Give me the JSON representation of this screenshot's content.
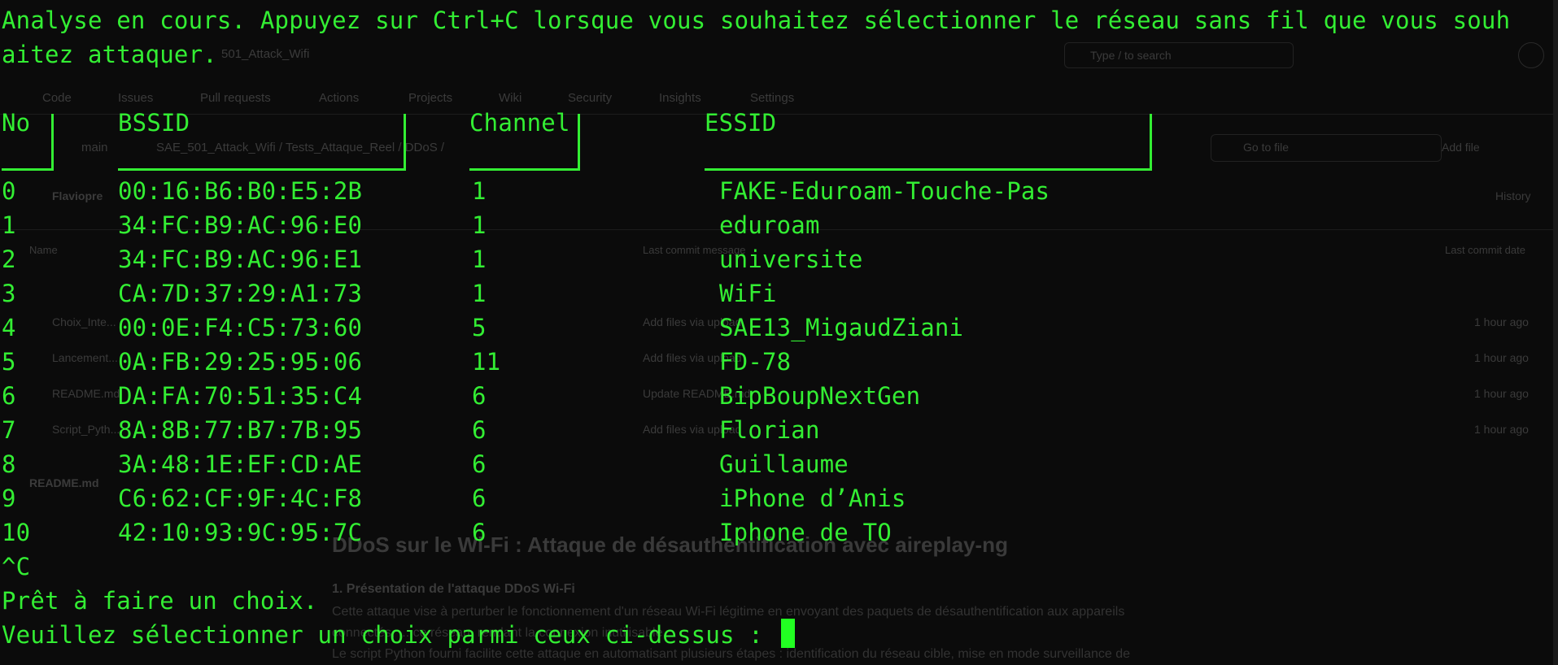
{
  "background_page": {
    "repo": "501_Attack_Wifi",
    "search_placeholder": "Type / to search",
    "nav": [
      "Code",
      "Issues",
      "Pull requests",
      "Actions",
      "Projects",
      "Wiki",
      "Security",
      "Insights",
      "Settings"
    ],
    "branch": "main",
    "breadcrumb": "SAE_501_Attack_Wifi / Tests_Attaque_Reel / DDoS /",
    "go_to_file": "Go to file",
    "add_file": "Add file",
    "author": "Flaviopre",
    "history": "History",
    "col_name": "Name",
    "col_commit": "Last commit message",
    "col_date": "Last commit date",
    "files": [
      "..",
      "Choix_Inte...",
      "Lancement...",
      "README.md",
      "Script_Pyth..."
    ],
    "commit_msgs": [
      "Add files via upload",
      "Add files via upload",
      "Update README.md",
      "Add files via upload"
    ],
    "times": [
      "1 hour ago",
      "1 hour ago",
      "1 hour ago",
      "1 hour ago"
    ],
    "readme_label": "README.md",
    "heading": "DDoS sur le Wi-Fi : Attaque de désauthentification avec aireplay-ng",
    "subheading": "1. Présentation de l'attaque DDoS Wi-Fi",
    "para1": "Cette attaque vise à perturber le fonctionnement d'un réseau Wi-Fi légitime en envoyant des paquets de désauthentification aux appareils",
    "para2": "connectés, ... ce réseau, rendant la connexion inutilisable.",
    "para3": "Le script Python fourni facilite cette attaque en automatisant plusieurs étapes : identification du réseau cible, mise en mode surveillance de"
  },
  "terminal": {
    "intro_line1": "Analyse en cours. Appuyez sur Ctrl+C lorsque vous souhaitez sélectionner le réseau sans fil que vous souh",
    "intro_line2": "aitez attaquer.",
    "headers": {
      "no": "No",
      "bssid": "BSSID",
      "channel": "Channel",
      "essid": "ESSID"
    },
    "rows": [
      {
        "no": "0",
        "bssid": "00:16:B6:B0:E5:2B",
        "channel": "1",
        "essid": "FAKE-Eduroam-Touche-Pas"
      },
      {
        "no": "1",
        "bssid": "34:FC:B9:AC:96:E0",
        "channel": "1",
        "essid": "eduroam"
      },
      {
        "no": "2",
        "bssid": "34:FC:B9:AC:96:E1",
        "channel": "1",
        "essid": "universite"
      },
      {
        "no": "3",
        "bssid": "CA:7D:37:29:A1:73",
        "channel": "1",
        "essid": "WiFi"
      },
      {
        "no": "4",
        "bssid": "00:0E:F4:C5:73:60",
        "channel": "5",
        "essid": "SAE13_MigaudZiani"
      },
      {
        "no": "5",
        "bssid": "0A:FB:29:25:95:06",
        "channel": "11",
        "essid": "FD-78"
      },
      {
        "no": "6",
        "bssid": "DA:FA:70:51:35:C4",
        "channel": "6",
        "essid": "BipBoupNextGen"
      },
      {
        "no": "7",
        "bssid": "8A:8B:77:B7:7B:95",
        "channel": "6",
        "essid": "Florian"
      },
      {
        "no": "8",
        "bssid": "3A:48:1E:EF:CD:AE",
        "channel": "6",
        "essid": "Guillaume"
      },
      {
        "no": "9",
        "bssid": "C6:62:CF:9F:4C:F8",
        "channel": "6",
        "essid": "iPhone d’Anis"
      },
      {
        "no": "10",
        "bssid": "42:10:93:9C:95:7C",
        "channel": "6",
        "essid": "Iphone de TO"
      }
    ],
    "interrupt": "^C",
    "ready": "Prêt à faire un choix.",
    "prompt": "Veuillez sélectionner un choix parmi ceux ci-dessus : "
  },
  "colors": {
    "terminal_text": "#33ee33",
    "terminal_bg": "#0b0b0b",
    "cursor": "#22ff22"
  }
}
